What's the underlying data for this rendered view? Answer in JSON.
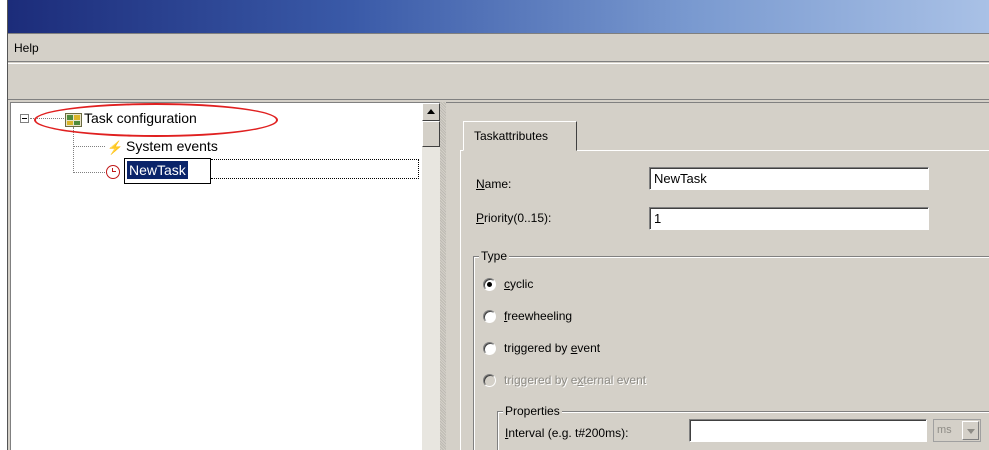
{
  "menu": {
    "help": "Help"
  },
  "tree": {
    "root_label": "Task configuration",
    "items": [
      {
        "label": "System events",
        "icon": "lightning-icon"
      },
      {
        "label": "NewTask",
        "icon": "clock-icon",
        "editing": true
      }
    ]
  },
  "panel": {
    "tab_label": "Taskattributes",
    "name_label_u": "N",
    "name_label_rest": "ame:",
    "name_value": "NewTask",
    "priority_label_u": "P",
    "priority_label_rest": "riority(0..15):",
    "priority_value": "1",
    "type_group": {
      "title": "Type",
      "options": [
        {
          "pre": "",
          "u": "c",
          "post": "yclic",
          "checked": true,
          "disabled": false
        },
        {
          "pre": "",
          "u": "f",
          "post": "reewheeling",
          "checked": false,
          "disabled": false
        },
        {
          "pre": "triggered by ",
          "u": "e",
          "post": "vent",
          "checked": false,
          "disabled": false
        },
        {
          "pre": "triggered by e",
          "u": "x",
          "post": "ternal event",
          "checked": false,
          "disabled": true
        }
      ]
    },
    "properties_group": {
      "title": "Properties",
      "interval_label_u": "I",
      "interval_label_rest": "nterval (e.g. t#200ms):",
      "interval_value": "",
      "unit_value": "ms"
    }
  },
  "colors": {
    "highlight": "#e02020",
    "selection": "#0a246a"
  }
}
